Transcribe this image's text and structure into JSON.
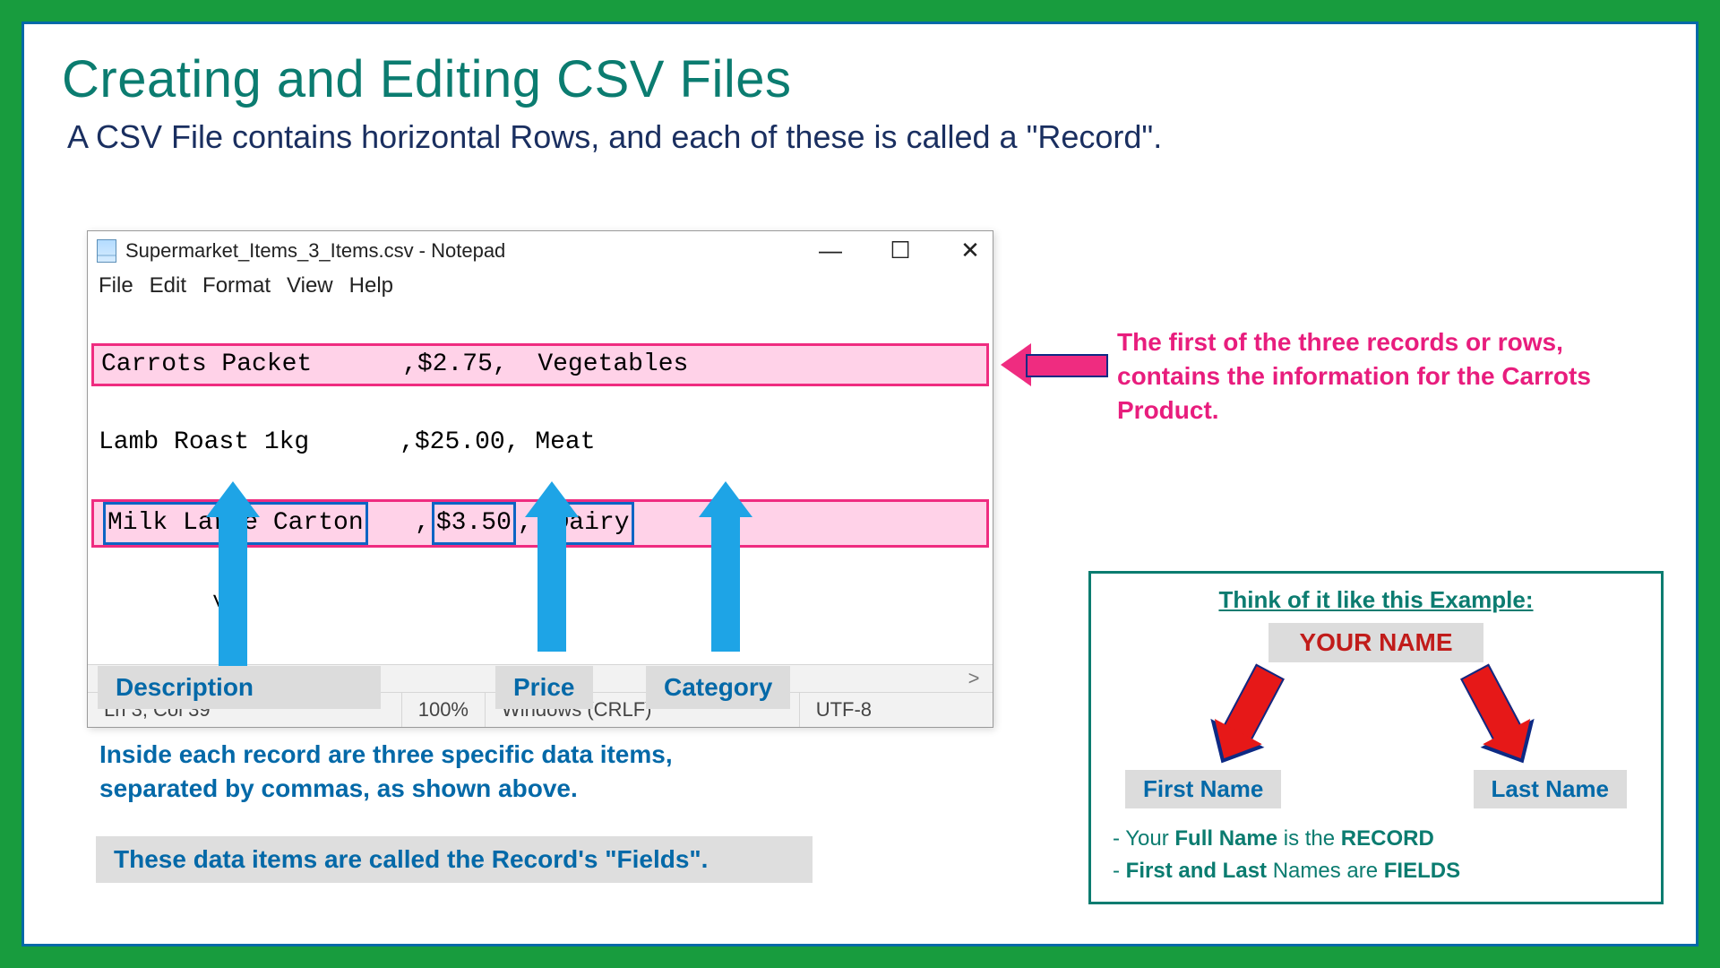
{
  "title": "Creating and Editing CSV Files",
  "subtitle": "A CSV File contains horizontal Rows, and each of these is called a \"Record\".",
  "notepad": {
    "window_title": "Supermarket_Items_3_Items.csv - Notepad",
    "controls": {
      "min": "—",
      "max": "☐",
      "close": "✕"
    },
    "menu": [
      "File",
      "Edit",
      "Format",
      "View",
      "Help"
    ],
    "rows": [
      {
        "desc": "Carrots Packet      ",
        "price": "$2.75",
        "cat": "Vegetables",
        "highlight": true,
        "boxed": false
      },
      {
        "desc": "Lamb Roast 1kg      ",
        "price": "$25.00",
        "cat": "Meat",
        "highlight": false,
        "boxed": false
      },
      {
        "desc": "Milk Large Carton",
        "price": "$3.50",
        "cat": "Dairy",
        "highlight": true,
        "boxed": true
      }
    ],
    "scroll": {
      "left": "<",
      "right": ">",
      "down": "˅"
    },
    "status": {
      "pos": "Ln 3, Col 39",
      "zoom": "100%",
      "le": "Windows (CRLF)",
      "enc": "UTF-8"
    }
  },
  "callout_pink": "The first of the three records or rows, contains the information for the Carrots Product.",
  "field_labels": {
    "desc": "Description",
    "price": "Price",
    "cat": "Category"
  },
  "explain1": "Inside each record are three specific data items, separated by commas, as shown above.",
  "explain2": "These data items are called the Record's \"Fields\".",
  "example": {
    "title": "Think of it like this Example:",
    "your_name": "YOUR NAME",
    "first": "First Name",
    "last": "Last Name",
    "line1_pre": "- Your ",
    "line1_b1": "Full Name",
    "line1_mid": " is the ",
    "line1_b2": "RECORD",
    "line2_pre": "- ",
    "line2_b1": "First and Last",
    "line2_mid": " Names are ",
    "line2_b2": "FIELDS"
  }
}
